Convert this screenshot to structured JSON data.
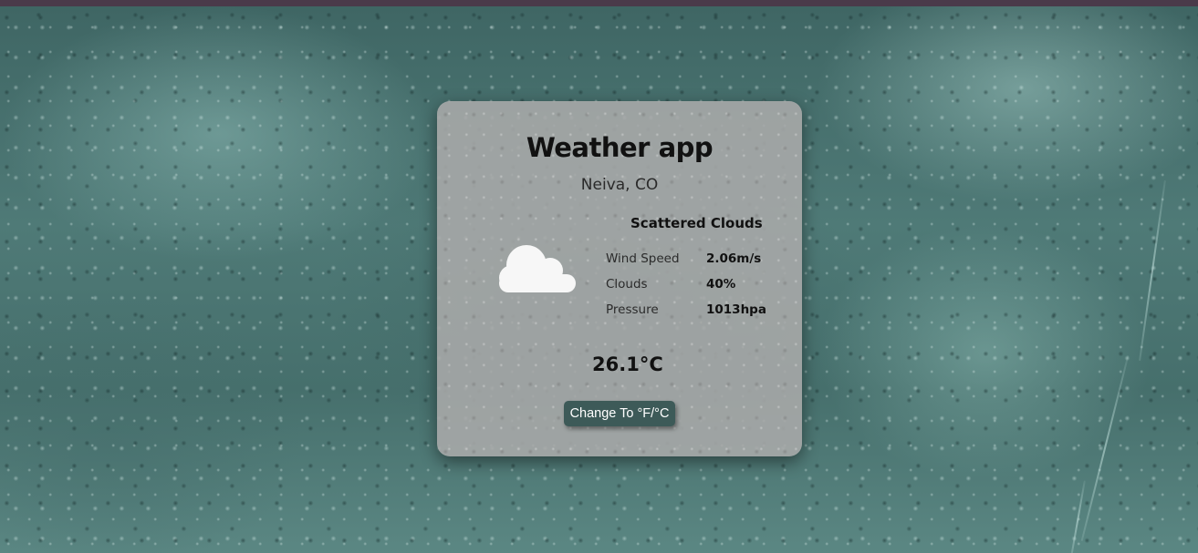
{
  "app": {
    "title": "Weather app",
    "location": "Neiva, CO",
    "description": "Scattered Clouds",
    "icon": "cloud-icon",
    "stats": [
      {
        "label": "Wind Speed",
        "value": "2.06m/s"
      },
      {
        "label": "Clouds",
        "value": "40%"
      },
      {
        "label": "Pressure",
        "value": "1013hpa"
      }
    ],
    "temperature": "26.1°C",
    "toggle_label": "Change To °F/°C"
  },
  "colors": {
    "button_bg": "#3d5a58",
    "card_bg": "#aaaaaa",
    "background": "#4f7a77"
  }
}
